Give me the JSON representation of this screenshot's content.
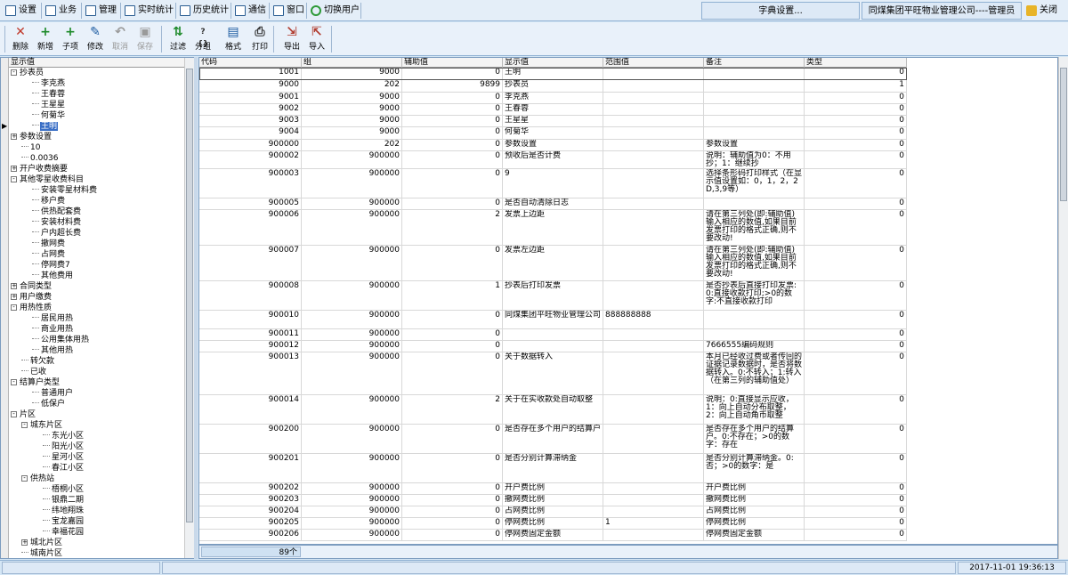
{
  "menubar": {
    "items": [
      {
        "label": "设置",
        "icon": "settings-icon"
      },
      {
        "label": "业务",
        "icon": "business-icon"
      },
      {
        "label": "管理",
        "icon": "manage-icon"
      },
      {
        "label": "实时统计",
        "icon": "realtime-stats-icon"
      },
      {
        "label": "历史统计",
        "icon": "history-stats-icon"
      },
      {
        "label": "通信",
        "icon": "communication-icon"
      },
      {
        "label": "窗口",
        "icon": "window-icon"
      },
      {
        "label": "切换用户",
        "icon": "switch-user-icon"
      }
    ],
    "dict_label": "字典设置...",
    "company_label": "同煤集团平旺物业管理公司----管理员",
    "close_label": "关闭"
  },
  "toolbar": {
    "buttons": [
      {
        "label": "删除",
        "icon": "delete-icon",
        "glyph": "✕",
        "color": "#c0392b",
        "enabled": true
      },
      {
        "label": "新增",
        "icon": "add-icon",
        "glyph": "+",
        "color": "#1e8a2a",
        "enabled": true
      },
      {
        "label": "子项",
        "icon": "add-child-icon",
        "glyph": "+",
        "color": "#1e8a2a",
        "enabled": true
      },
      {
        "label": "修改",
        "icon": "edit-icon",
        "glyph": "✎",
        "color": "#1b5aa0",
        "enabled": true
      },
      {
        "label": "取消",
        "icon": "cancel-icon",
        "glyph": "↶",
        "color": "#9a9a9a",
        "enabled": false
      },
      {
        "label": "保存",
        "icon": "save-icon",
        "glyph": "▣",
        "color": "#9a9a9a",
        "enabled": false
      },
      {
        "label": "过滤",
        "icon": "filter-icon",
        "glyph": "⇅",
        "color": "#1e8a2a",
        "enabled": true
      },
      {
        "label": "分组",
        "icon": "group-icon",
        "glyph": "?{}",
        "color": "#333333",
        "enabled": true
      },
      {
        "label": "格式",
        "icon": "format-icon",
        "glyph": "▤",
        "color": "#1b5aa0",
        "enabled": true
      },
      {
        "label": "打印",
        "icon": "print-icon",
        "glyph": "⎙",
        "color": "#333333",
        "enabled": true
      },
      {
        "label": "导出",
        "icon": "export-icon",
        "glyph": "⇲",
        "color": "#b0392b",
        "enabled": true
      },
      {
        "label": "导入",
        "icon": "import-icon",
        "glyph": "⇱",
        "color": "#b0392b",
        "enabled": true
      }
    ]
  },
  "tree": {
    "header": "显示值",
    "nodes": [
      {
        "label": "抄表员",
        "level": 0,
        "toggle": "-"
      },
      {
        "label": "李克燕",
        "level": 2
      },
      {
        "label": "王春蓉",
        "level": 2
      },
      {
        "label": "王星星",
        "level": 2
      },
      {
        "label": "何菊华",
        "level": 2
      },
      {
        "label": "王明",
        "level": 2,
        "selected": true
      },
      {
        "label": "参数设置",
        "level": 0,
        "toggle": "+"
      },
      {
        "label": "10",
        "level": 1
      },
      {
        "label": "0.0036",
        "level": 1
      },
      {
        "label": "开户收费摘要",
        "level": 0,
        "toggle": "+"
      },
      {
        "label": "其他零星收费科目",
        "level": 0,
        "toggle": "-"
      },
      {
        "label": "安装零星材料费",
        "level": 2
      },
      {
        "label": "移户费",
        "level": 2
      },
      {
        "label": "供热配套费",
        "level": 2
      },
      {
        "label": "安装材料费",
        "level": 2
      },
      {
        "label": "户内超长费",
        "level": 2
      },
      {
        "label": "撤网费",
        "level": 2
      },
      {
        "label": "占网费",
        "level": 2
      },
      {
        "label": "停网费7",
        "level": 2
      },
      {
        "label": "其他费用",
        "level": 2
      },
      {
        "label": "合同类型",
        "level": 0,
        "toggle": "+"
      },
      {
        "label": "用户缴费",
        "level": 0,
        "toggle": "+"
      },
      {
        "label": "用热性质",
        "level": 0,
        "toggle": "-"
      },
      {
        "label": "居民用热",
        "level": 2
      },
      {
        "label": "商业用热",
        "level": 2
      },
      {
        "label": "公用集体用热",
        "level": 2
      },
      {
        "label": "其他用热",
        "level": 2
      },
      {
        "label": "转欠款",
        "level": 1
      },
      {
        "label": "已收",
        "level": 1
      },
      {
        "label": "结算户类型",
        "level": 0,
        "toggle": "-"
      },
      {
        "label": "普通用户",
        "level": 2
      },
      {
        "label": "低保户",
        "level": 2
      },
      {
        "label": "片区",
        "level": 0,
        "toggle": "-"
      },
      {
        "label": "城东片区",
        "level": 1,
        "toggle": "-"
      },
      {
        "label": "东光小区",
        "level": 3
      },
      {
        "label": "阳光小区",
        "level": 3
      },
      {
        "label": "星河小区",
        "level": 3
      },
      {
        "label": "春江小区",
        "level": 3
      },
      {
        "label": "供热站",
        "level": 1,
        "toggle": "-"
      },
      {
        "label": "梧桐小区",
        "level": 3
      },
      {
        "label": "银鼎二期",
        "level": 3
      },
      {
        "label": "纬地翔珠",
        "level": 3
      },
      {
        "label": "宝龙嘉园",
        "level": 3
      },
      {
        "label": "幸福花园",
        "level": 3
      },
      {
        "label": "城北片区",
        "level": 1,
        "toggle": "+"
      },
      {
        "label": "城南片区",
        "level": 1
      }
    ]
  },
  "grid": {
    "columns": [
      "代码",
      "组",
      "辅助值",
      "显示值",
      "范围值",
      "备注",
      "类型"
    ],
    "rows": [
      {
        "code": "1001",
        "group": "9000",
        "aux": "0",
        "value": "王明",
        "range": "",
        "note": "",
        "type": "0"
      },
      {
        "code": "9000",
        "group": "202",
        "aux": "9899",
        "value": "抄表员",
        "range": "",
        "note": "",
        "type": "1"
      },
      {
        "code": "9001",
        "group": "9000",
        "aux": "0",
        "value": "李克燕",
        "range": "",
        "note": "",
        "type": "0"
      },
      {
        "code": "9002",
        "group": "9000",
        "aux": "0",
        "value": "王春蓉",
        "range": "",
        "note": "",
        "type": "0"
      },
      {
        "code": "9003",
        "group": "9000",
        "aux": "0",
        "value": "王星星",
        "range": "",
        "note": "",
        "type": "0"
      },
      {
        "code": "9004",
        "group": "9000",
        "aux": "0",
        "value": "何菊华",
        "range": "",
        "note": "",
        "type": "0"
      },
      {
        "code": "900000",
        "group": "202",
        "aux": "0",
        "value": "参数设置",
        "range": "",
        "note": "参数设置",
        "type": "0"
      },
      {
        "code": "900002",
        "group": "900000",
        "aux": "0",
        "value": "预收后是否计费",
        "range": "",
        "note": "说明：辅助值为0：不用抄；1：继续抄",
        "type": "0"
      },
      {
        "code": "900003",
        "group": "900000",
        "aux": "0",
        "value": "9",
        "range": "",
        "note": "选择条形码打印样式（在显示值设置如：0，1，2，2D,3,9等）",
        "type": "0"
      },
      {
        "code": "900005",
        "group": "900000",
        "aux": "0",
        "value": "是否自动清除日志",
        "range": "",
        "note": "",
        "type": "0"
      },
      {
        "code": "900006",
        "group": "900000",
        "aux": "2",
        "value": "发票上边距",
        "range": "",
        "note": "请在第三列处(即:辅助值)输入相应的数值,如果目前发票打印的格式正确,则不要改动!",
        "type": "0"
      },
      {
        "code": "900007",
        "group": "900000",
        "aux": "0",
        "value": "发票左边距",
        "range": "",
        "note": "请在第三列处(即:辅助值)输入相应的数值,如果目前发票打印的格式正确,则不要改动!",
        "type": "0"
      },
      {
        "code": "900008",
        "group": "900000",
        "aux": "1",
        "value": "抄表后打印发票",
        "range": "",
        "note": "是否抄表后直接打印发票:0:直接收款打印;>0的数字:不直接收款打印",
        "type": "0"
      },
      {
        "code": "900010",
        "group": "900000",
        "aux": "0",
        "value": "同煤集团平旺物业管理公司",
        "range": "888888888",
        "note": "",
        "type": "0"
      },
      {
        "code": "900011",
        "group": "900000",
        "aux": "0",
        "value": "",
        "range": "",
        "note": "",
        "type": "0"
      },
      {
        "code": "900012",
        "group": "900000",
        "aux": "0",
        "value": "",
        "range": "",
        "note": "7666555编码规则",
        "type": "0"
      },
      {
        "code": "900013",
        "group": "900000",
        "aux": "0",
        "value": "关于数据转入",
        "range": "",
        "note": "本月已经收过费或者传回的证据记录数据时，是否将数据转入。0:不转入；1:转入（在第三列的辅助值处）",
        "type": "0"
      },
      {
        "code": "900014",
        "group": "900000",
        "aux": "2",
        "value": "关于在实收款处自动取整",
        "range": "",
        "note": "说明：0:直接显示应收，1：向上自动分布取整，2：向上自动角币取整",
        "type": "0"
      },
      {
        "code": "900200",
        "group": "900000",
        "aux": "0",
        "value": "是否存在多个用户的结算户",
        "range": "",
        "note": "是否存在多个用户的结算户。0:不存在；>0的数字：存在",
        "type": "0"
      },
      {
        "code": "900201",
        "group": "900000",
        "aux": "0",
        "value": "是否分别计算滞纳金",
        "range": "",
        "note": "是否分别计算滞纳金。0:否；>0的数字：是",
        "type": "0"
      },
      {
        "code": "900202",
        "group": "900000",
        "aux": "0",
        "value": "开户费比例",
        "range": "",
        "note": "开户费比例",
        "type": "0"
      },
      {
        "code": "900203",
        "group": "900000",
        "aux": "0",
        "value": "撤网费比例",
        "range": "",
        "note": "撤网费比例",
        "type": "0"
      },
      {
        "code": "900204",
        "group": "900000",
        "aux": "0",
        "value": "占网费比例",
        "range": "",
        "note": "占网费比例",
        "type": "0"
      },
      {
        "code": "900205",
        "group": "900000",
        "aux": "0",
        "value": "停网费比例",
        "range": "1",
        "note": "停网费比例",
        "type": "0"
      },
      {
        "code": "900206",
        "group": "900000",
        "aux": "0",
        "value": "停网费固定金额",
        "range": "",
        "note": "停网费固定金额",
        "type": "0"
      }
    ],
    "count": "89个"
  },
  "status": {
    "left": "",
    "mid": "",
    "datetime": "2017-11-01  19:36:13"
  }
}
